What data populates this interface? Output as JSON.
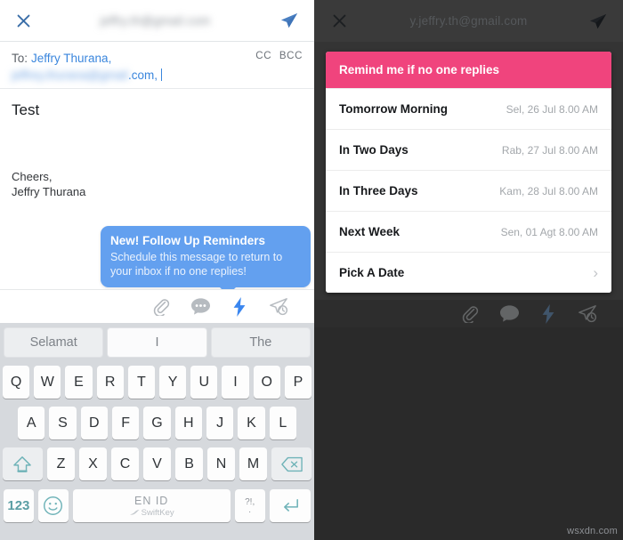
{
  "compose": {
    "header": {
      "close_icon": "close-icon",
      "account_blurred": "jeffry.th@gmail.com",
      "send_icon": "send-icon"
    },
    "to": {
      "label": "To:",
      "recipient_name": "Jeffry Thurana,",
      "cc": "CC",
      "bcc": "BCC",
      "blurred_email": "jeffrey.thurana@gmail",
      "email_tail": ".com,"
    },
    "subject": "Test",
    "body_lines": [
      "Cheers,",
      "Jeffry Thurana"
    ],
    "tooltip": {
      "title": "New! Follow Up Reminders",
      "body": "Schedule this message to return to your inbox if no one replies!"
    },
    "toolbar": [
      {
        "name": "attach-icon",
        "label": "Attach"
      },
      {
        "name": "chat-bubble-icon",
        "label": "Follow up reminders"
      },
      {
        "name": "lightning-bolt-icon",
        "label": "Quick actions"
      },
      {
        "name": "send-later-icon",
        "label": "Send later"
      }
    ]
  },
  "keyboard": {
    "predictions": [
      "Selamat",
      "I",
      "The"
    ],
    "row1": [
      "Q",
      "W",
      "E",
      "R",
      "T",
      "Y",
      "U",
      "I",
      "O",
      "P"
    ],
    "row2": [
      "A",
      "S",
      "D",
      "F",
      "G",
      "H",
      "J",
      "K",
      "L"
    ],
    "row3": [
      "Z",
      "X",
      "C",
      "V",
      "B",
      "N",
      "M"
    ],
    "shift_icon": "shift-icon",
    "backspace_icon": "backspace-icon",
    "numbers_key": "123",
    "emoji_icon": "emoji-icon",
    "space_language": "EN ID",
    "space_brand": "SwiftKey",
    "punct_top": "?!,",
    "punct_bottom": ".",
    "enter_icon": "enter-icon"
  },
  "reminder": {
    "header": {
      "close_icon": "close-icon",
      "account": "y.jeffry.th@gmail.com",
      "send_icon": "send-icon"
    },
    "card_title": "Remind me if no one replies",
    "items": [
      {
        "label": "Tomorrow Morning",
        "when": "Sel, 26 Jul 8.00 AM",
        "chevron": false
      },
      {
        "label": "In Two Days",
        "when": "Rab, 27 Jul 8.00 AM",
        "chevron": false
      },
      {
        "label": "In Three Days",
        "when": "Kam, 28 Jul 8.00 AM",
        "chevron": false
      },
      {
        "label": "Next Week",
        "when": "Sen, 01 Agt 8.00 AM",
        "chevron": false
      },
      {
        "label": "Pick A Date",
        "when": "",
        "chevron": true
      }
    ]
  },
  "watermark": "wsxdn.com",
  "colors": {
    "accent_blue": "#3a86dd",
    "tooltip_blue": "#63a0ef",
    "pink": "#f0447d",
    "keyboard_bg": "#d6d9dd",
    "dim_bg": "#343434",
    "teal_key": "#5fa8ae"
  }
}
